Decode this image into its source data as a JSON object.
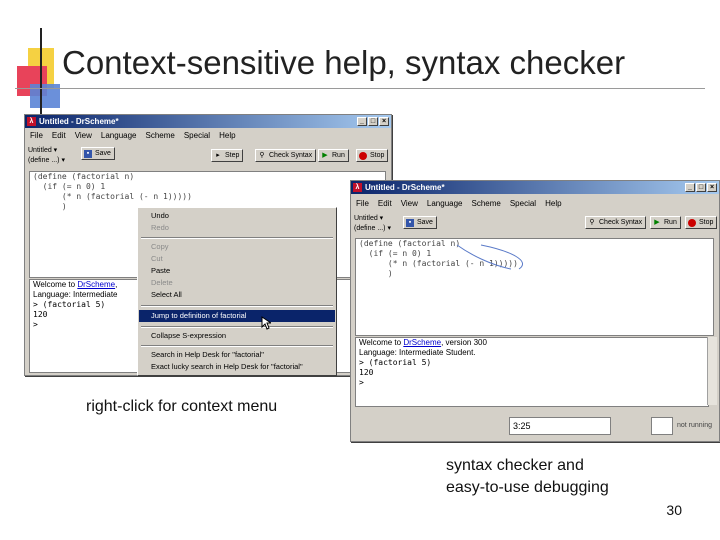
{
  "slide": {
    "title": "Context-sensitive help, syntax checker",
    "caption_left": "right-click for context menu",
    "caption_right_line1": "syntax checker and",
    "caption_right_line2": "easy-to-use debugging",
    "page_number": "30"
  },
  "window1": {
    "title": "Untitled - DrScheme*",
    "menu": [
      "File",
      "Edit",
      "View",
      "Language",
      "Scheme",
      "Special",
      "Help"
    ],
    "combo_file": "Untitled ▾",
    "combo_define": "(define ...) ▾",
    "buttons": {
      "save": "Save",
      "step": "Step",
      "check_syntax": "Check Syntax",
      "run": "Run",
      "stop": "Stop"
    },
    "editor_lines": [
      "(define (factorial n)",
      "  (if (= n 0) 1",
      "      (* n (factorial (- n 1)))))",
      "      )",
      "   "
    ],
    "repl": {
      "welcome_prefix": "Welcome to ",
      "welcome_link": "DrScheme",
      "welcome_rest": ", ",
      "language": "Language: Intermediate",
      "expr": "> (factorial 5)",
      "result": "120",
      "prompt": ">"
    }
  },
  "context_menu": {
    "items": [
      "Undo",
      "Redo",
      "Copy",
      "Cut",
      "Paste",
      "Delete",
      "Select All",
      "Jump to definition of factorial",
      "Collapse S-expression",
      "Search in Help Desk for \"factorial\"",
      "Exact lucky search in Help Desk for \"factorial\""
    ]
  },
  "window2": {
    "title": "Untitled - DrScheme*",
    "menu": [
      "File",
      "Edit",
      "View",
      "Language",
      "Scheme",
      "Special",
      "Help"
    ],
    "combo_file": "Untitled ▾",
    "combo_define": "(define ...) ▾",
    "buttons": {
      "save": "Save",
      "check_syntax": "Check Syntax",
      "run": "Run",
      "stop": "Stop"
    },
    "editor_lines": [
      "(define (factorial n)",
      "  (if (= n 0) 1",
      "      (* n (factorial (- n 1)))))",
      "      )",
      "   "
    ],
    "repl": {
      "welcome_prefix": "Welcome to ",
      "welcome_link": "DrScheme",
      "welcome_rest": ", version 300",
      "language": "Language: Intermediate Student.",
      "expr": "> (factorial 5)",
      "result": "120",
      "prompt": ">"
    },
    "status_position": "3:25",
    "status_mode": "not running"
  },
  "colors": {
    "title_bar": "#0a246a",
    "selection": "#0a246a",
    "link": "#0000cc",
    "deco_red": "#e8435a",
    "deco_yellow": "#f5d142",
    "deco_blue": "#5b84d6"
  }
}
